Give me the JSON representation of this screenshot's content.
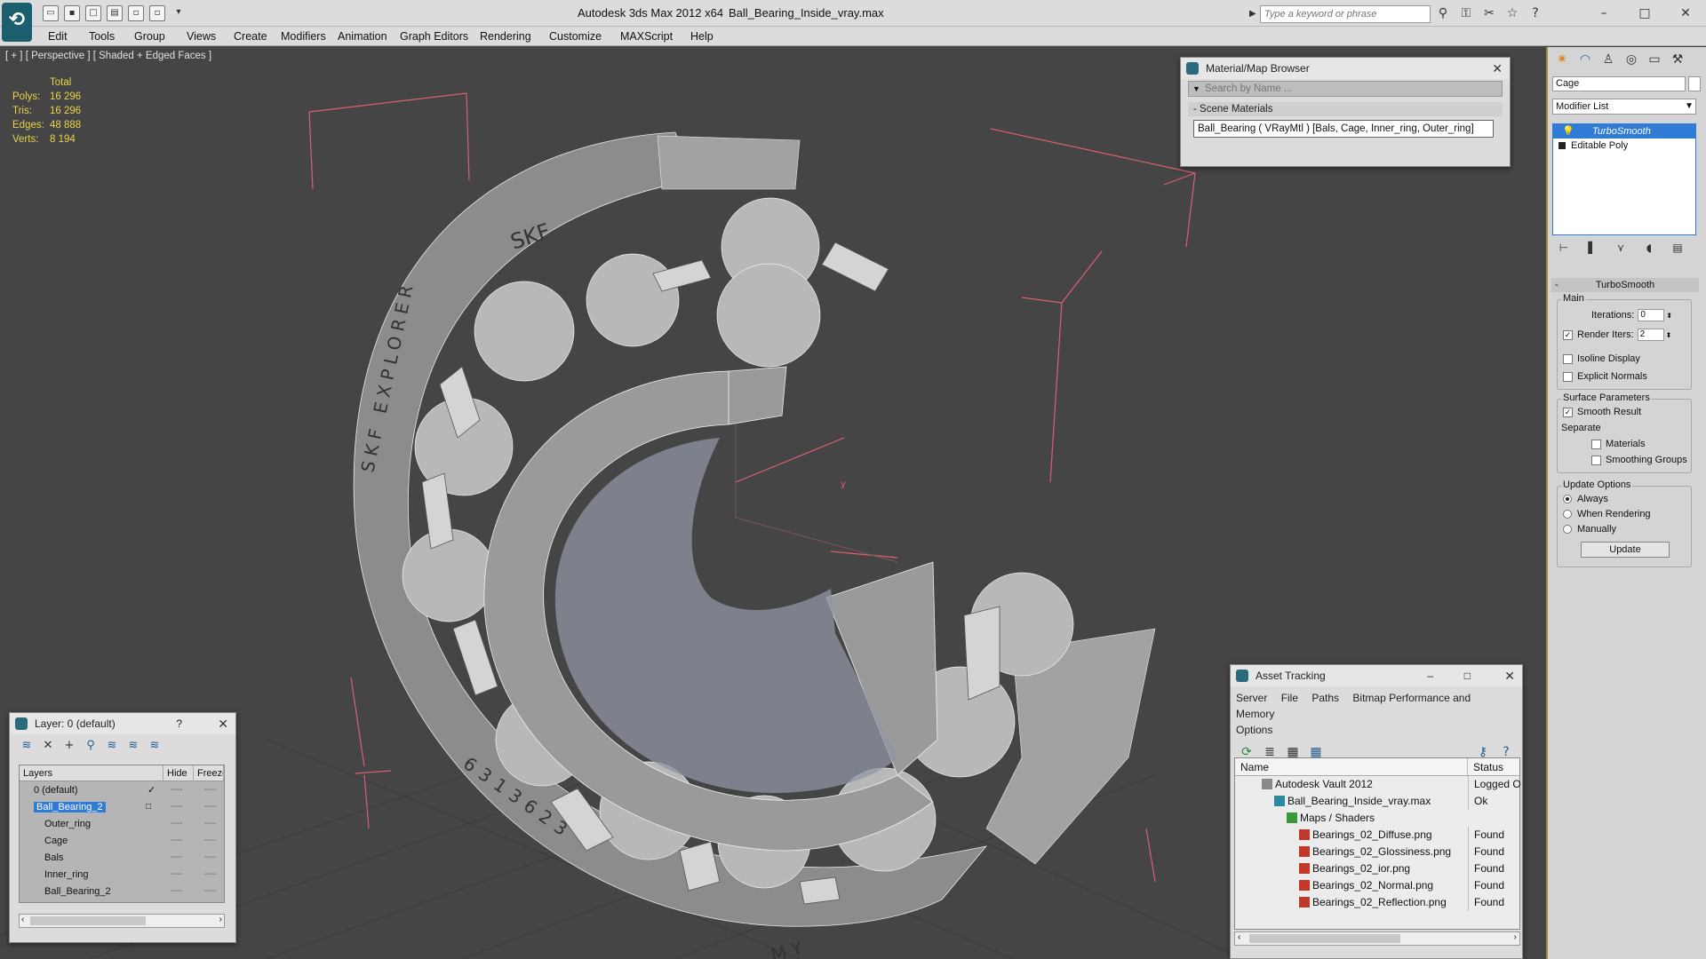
{
  "titlebar": {
    "app_title": "Autodesk 3ds Max  2012 x64",
    "file_name": "Ball_Bearing_Inside_vray.max",
    "search_placeholder": "Type a keyword or phrase"
  },
  "menu": [
    "Edit",
    "Tools",
    "Group",
    "Views",
    "Create",
    "Modifiers",
    "Animation",
    "Graph Editors",
    "Rendering",
    "Customize",
    "MAXScript",
    "Help"
  ],
  "viewport": {
    "label": "[ + ] [ Perspective ] [ Shaded + Edged Faces ]",
    "stats_header": "Total",
    "stats": [
      {
        "k": "Polys:",
        "v": "16 296"
      },
      {
        "k": "Tris:",
        "v": "16 296"
      },
      {
        "k": "Edges:",
        "v": "48 888"
      },
      {
        "k": "Verts:",
        "v": "8 194"
      }
    ],
    "engraving_brand": "SKF",
    "engraving_series": "SKF EXPLORER",
    "engraving_code": "6313623",
    "engraving_short": "MY"
  },
  "material_browser": {
    "title": "Material/Map Browser",
    "search_placeholder": "Search by Name ...",
    "section": "- Scene Materials",
    "item": "Ball_Bearing  ( VRayMtl )  [Bals, Cage, Inner_ring, Outer_ring]"
  },
  "layer_window": {
    "title": "Layer: 0 (default)",
    "help": "?",
    "col_layers": "Layers",
    "col_hide": "Hide",
    "col_freeze": "Freeze",
    "rows": [
      {
        "name": "0 (default)",
        "indent": 16
      },
      {
        "name": "Ball_Bearing_2",
        "indent": 16
      },
      {
        "name": "Outer_ring",
        "indent": 28
      },
      {
        "name": "Cage",
        "indent": 28
      },
      {
        "name": "Bals",
        "indent": 28
      },
      {
        "name": "Inner_ring",
        "indent": 28
      },
      {
        "name": "Ball_Bearing_2",
        "indent": 28
      }
    ],
    "dash": "----"
  },
  "asset_tracking": {
    "title": "Asset Tracking",
    "menu": [
      "Server",
      "File",
      "Paths",
      "Bitmap Performance and Memory"
    ],
    "menu2": "Options",
    "col_name": "Name",
    "col_status": "Status",
    "rows": [
      {
        "name": "Autodesk Vault 2012",
        "status": "Logged Ou",
        "indent": 30,
        "icon": "vault-icon"
      },
      {
        "name": "Ball_Bearing_Inside_vray.max",
        "status": "Ok",
        "indent": 44,
        "icon": "max-file-icon"
      },
      {
        "name": "Maps / Shaders",
        "status": "",
        "indent": 58,
        "icon": "maps-icon"
      },
      {
        "name": "Bearings_02_Diffuse.png",
        "status": "Found",
        "indent": 72,
        "icon": "png-icon"
      },
      {
        "name": "Bearings_02_Glossiness.png",
        "status": "Found",
        "indent": 72,
        "icon": "png-icon"
      },
      {
        "name": "Bearings_02_ior.png",
        "status": "Found",
        "indent": 72,
        "icon": "png-icon"
      },
      {
        "name": "Bearings_02_Normal.png",
        "status": "Found",
        "indent": 72,
        "icon": "png-icon"
      },
      {
        "name": "Bearings_02_Reflection.png",
        "status": "Found",
        "indent": 72,
        "icon": "png-icon"
      }
    ]
  },
  "command_panel": {
    "object_name": "Cage",
    "modifier_list": "Modifier List",
    "stack": [
      "TurboSmooth",
      "Editable Poly"
    ],
    "rollout_title": "TurboSmooth",
    "main_label": "Main",
    "iterations_label": "Iterations:",
    "iterations_value": "0",
    "render_iters_label": "Render Iters:",
    "render_iters_value": "2",
    "render_iters_checked": true,
    "isoline_label": "Isoline Display",
    "explicit_label": "Explicit Normals",
    "surface_label": "Surface Parameters",
    "smooth_result_label": "Smooth Result",
    "smooth_result_checked": true,
    "separate_label": "Separate",
    "materials_label": "Materials",
    "smoothing_groups_label": "Smoothing Groups",
    "update_options_label": "Update Options",
    "always_label": "Always",
    "when_rendering_label": "When Rendering",
    "manually_label": "Manually",
    "update_button": "Update"
  },
  "colors": {
    "stats_text": "#e8d34a",
    "selection": "#2f7bd6",
    "bbox_lines": "#d86070",
    "viewport_bg": "#454545"
  }
}
